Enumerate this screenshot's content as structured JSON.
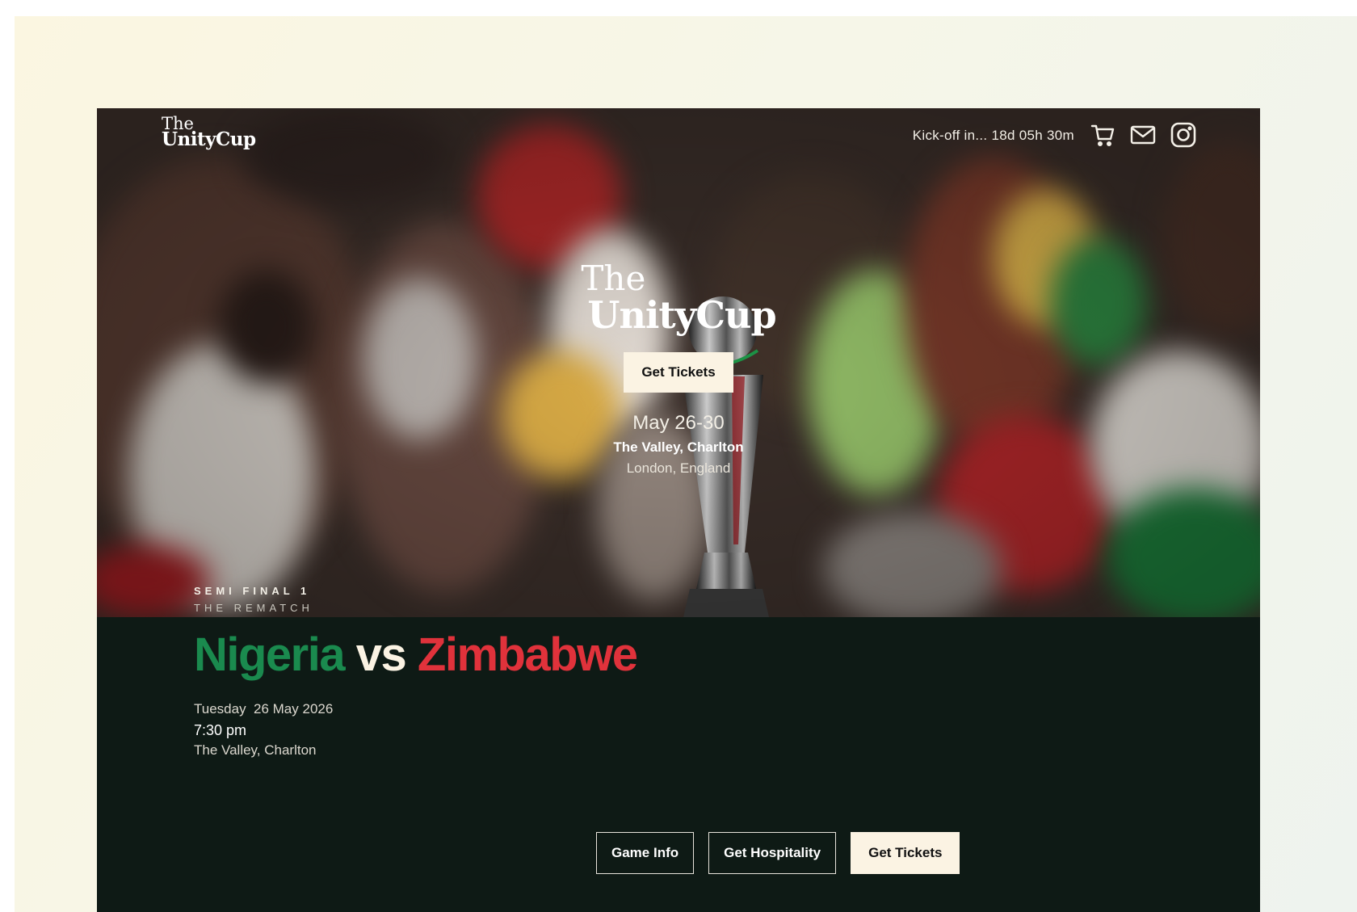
{
  "brand": {
    "logo_the": "The",
    "logo_name": "UnityCup"
  },
  "header": {
    "countdown_label": "Kick-off in... 18d 05h 30m",
    "icons": [
      "cart-icon",
      "mail-icon",
      "instagram-icon"
    ]
  },
  "hero": {
    "logo_the": "The",
    "logo_name": "UnityCup",
    "cta_label": "Get Tickets",
    "dates": "May 26-30",
    "venue": "The Valley, Charlton",
    "city": "London, England"
  },
  "match": {
    "stage": "SEMI FINAL 1",
    "tagline": "THE REMATCH",
    "team_home": "Nigeria",
    "vs": "vs",
    "team_away": "Zimbabwe",
    "date": "Tuesday  26 May 2026",
    "time": "7:30 pm",
    "venue": "The Valley, Charlton",
    "buttons": {
      "game_info": "Game Info",
      "hospitality": "Get Hospitality",
      "tickets": "Get Tickets"
    }
  },
  "colors": {
    "home_team": "#1a8a4e",
    "away_team": "#e0323b",
    "cream": "#fbf3e3",
    "section_bg": "#0e1a15"
  }
}
